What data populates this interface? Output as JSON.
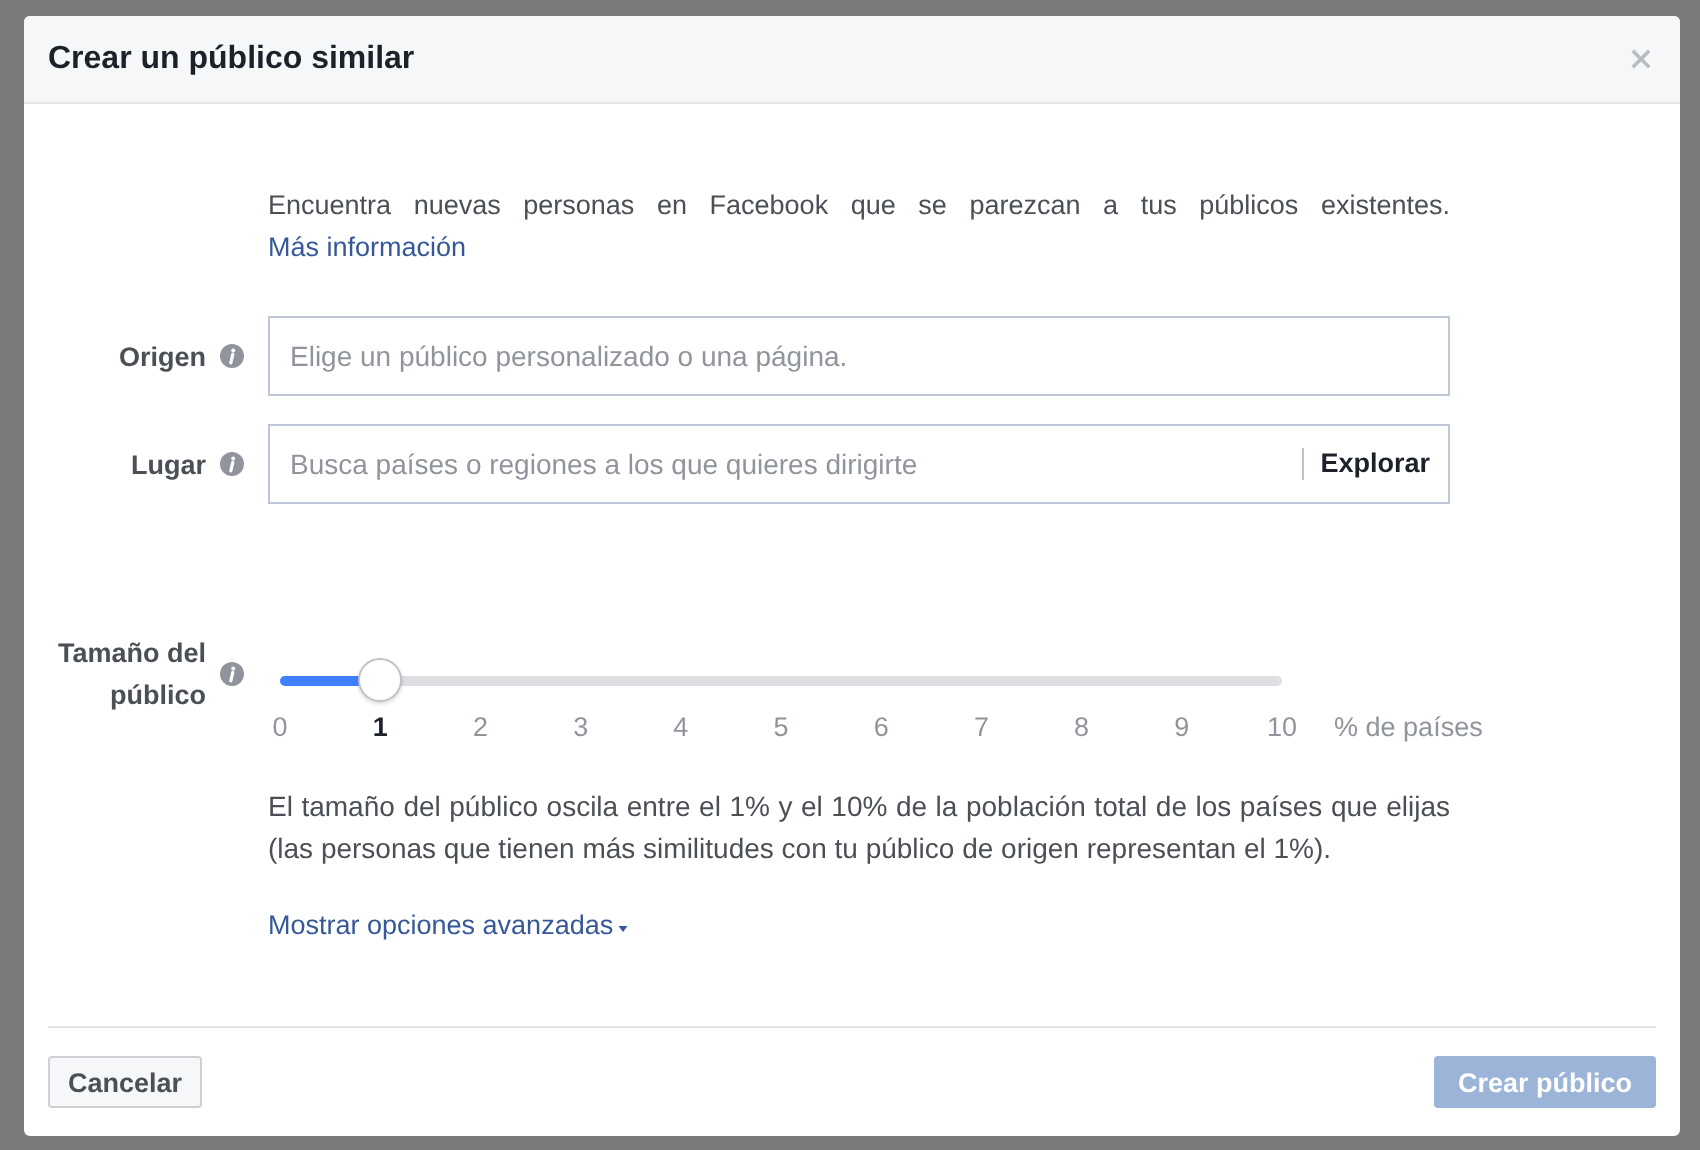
{
  "dialog": {
    "title": "Crear un público similar"
  },
  "intro": {
    "text": "Encuentra nuevas personas en Facebook que se parezcan a tus públicos existentes.",
    "link": "Más información"
  },
  "fields": [
    {
      "label": "Origen",
      "placeholder": "Elige un público personalizado o una página."
    },
    {
      "label": "Lugar",
      "placeholder": "Busca países o regiones a los que quieres dirigirte",
      "action": "Explorar"
    }
  ],
  "audience_size": {
    "label": "Tamaño del público",
    "level": 0.1,
    "ticks": [
      {
        "label": "0",
        "selected": false
      },
      {
        "label": "1",
        "selected": true
      },
      {
        "label": "2",
        "selected": false
      },
      {
        "label": "3",
        "selected": false
      },
      {
        "label": "4",
        "selected": false
      },
      {
        "label": "5",
        "selected": false
      },
      {
        "label": "6",
        "selected": false
      },
      {
        "label": "7",
        "selected": false
      },
      {
        "label": "8",
        "selected": false
      },
      {
        "label": "9",
        "selected": false
      },
      {
        "label": "10",
        "selected": false
      }
    ],
    "unit": "% de países",
    "description": "El tamaño del público oscila entre el 1% y el 10% de la población total de los países que elijas (las personas que tienen más similitudes con tu público de origen representan el 1%).",
    "advanced_link": "Mostrar opciones avanzadas"
  },
  "buttons": [
    {
      "label": "Cancelar",
      "kind": "secondary",
      "disabled": false
    },
    {
      "label": "Crear público",
      "kind": "primary",
      "disabled": true
    }
  ]
}
